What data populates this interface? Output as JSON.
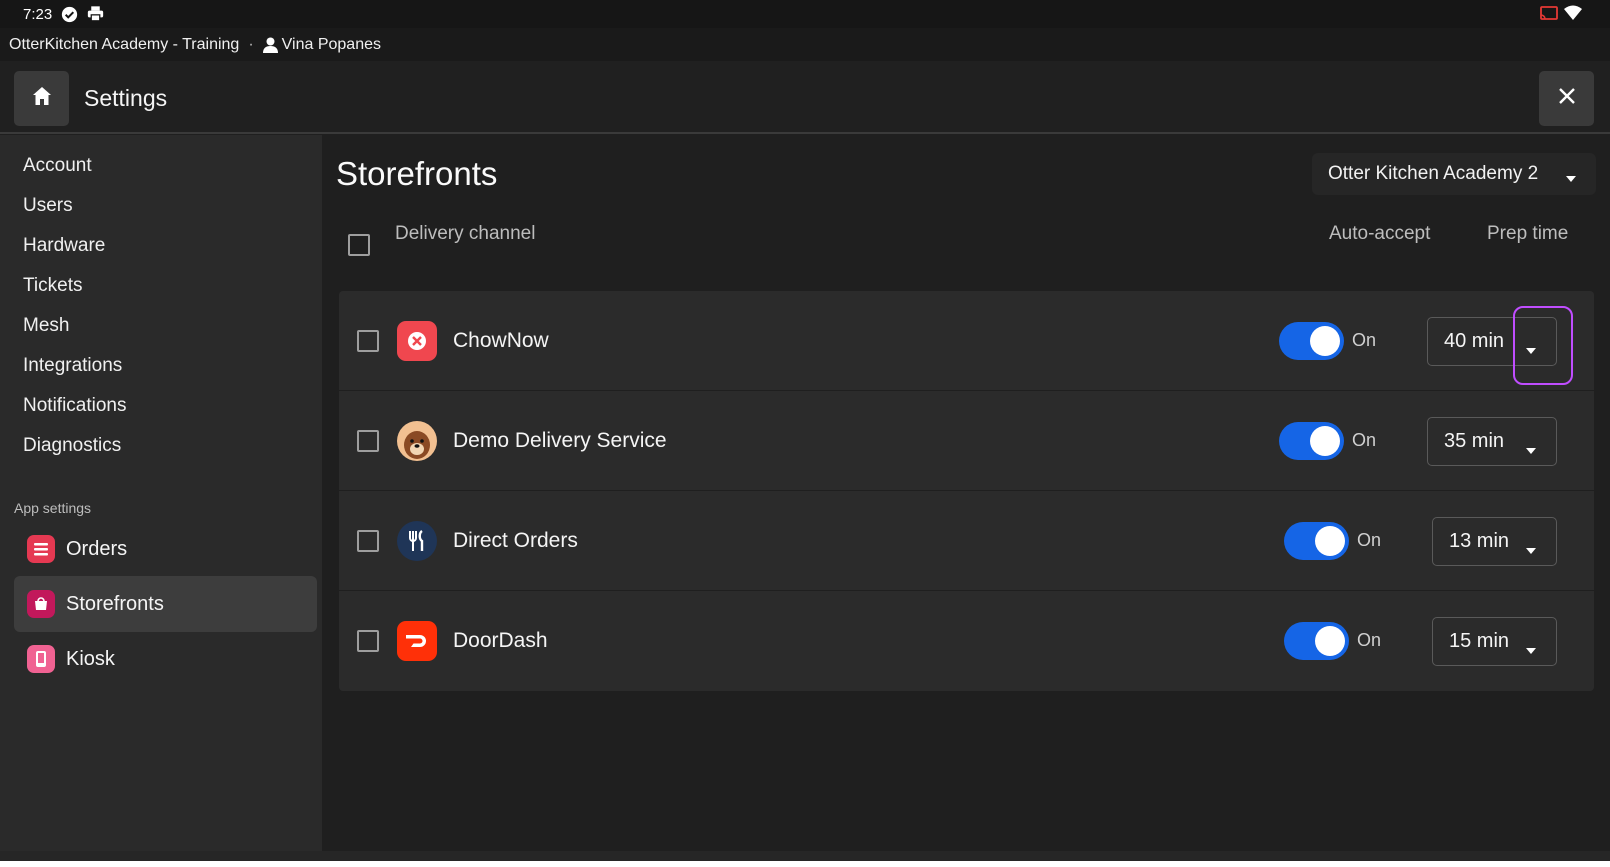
{
  "status_bar": {
    "time": "7:23",
    "icons": [
      "check-circle-icon",
      "printer-icon",
      "cast-icon",
      "wifi-icon"
    ]
  },
  "session": {
    "org": "OtterKitchen Academy - Training",
    "separator": "·",
    "user": "Vina Popanes"
  },
  "header": {
    "title": "Settings"
  },
  "sidebar": {
    "items": [
      {
        "label": "Account"
      },
      {
        "label": "Users"
      },
      {
        "label": "Hardware"
      },
      {
        "label": "Tickets"
      },
      {
        "label": "Mesh"
      },
      {
        "label": "Integrations"
      },
      {
        "label": "Notifications"
      },
      {
        "label": "Diagnostics"
      }
    ],
    "app_settings_label": "App settings",
    "app_items": [
      {
        "label": "Orders",
        "icon": "orders-icon",
        "color": "#e53952"
      },
      {
        "label": "Storefronts",
        "icon": "storefronts-icon",
        "color": "#c2185b",
        "active": true
      },
      {
        "label": "Kiosk",
        "icon": "kiosk-icon",
        "color": "#f06292"
      }
    ]
  },
  "main": {
    "title": "Storefronts",
    "store_selector": "Otter Kitchen Academy 2",
    "columns": {
      "channel": "Delivery channel",
      "auto_accept": "Auto-accept",
      "prep_time": "Prep time"
    },
    "rows": [
      {
        "name": "ChowNow",
        "logo": "chownow-logo-icon",
        "logo_color": "#f0474f",
        "auto_accept": "On",
        "prep_time": "40 min"
      },
      {
        "name": "Demo Delivery Service",
        "logo": "otter-logo-icon",
        "logo_color": "#f2c091",
        "auto_accept": "On",
        "prep_time": "35 min"
      },
      {
        "name": "Direct Orders",
        "logo": "fork-knife-icon",
        "logo_color": "#1f3557",
        "auto_accept": "On",
        "prep_time": "13 min"
      },
      {
        "name": "DoorDash",
        "logo": "doordash-logo-icon",
        "logo_color": "#ff3008",
        "auto_accept": "On",
        "prep_time": "15 min"
      }
    ]
  },
  "colors": {
    "toggle_on": "#1565e6",
    "highlight": "#c04dff",
    "background": "#1f1f1f",
    "sidebar": "#2a2a2a"
  }
}
